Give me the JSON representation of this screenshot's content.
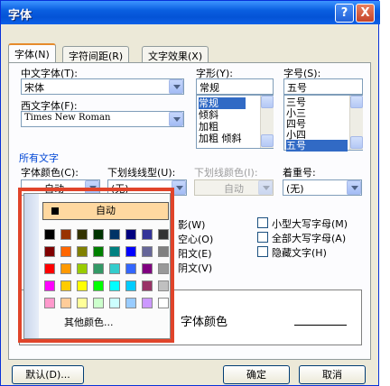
{
  "dialog": {
    "title": "字体",
    "help_label": "?",
    "close_label": "X"
  },
  "tabs": [
    "字体(N)",
    "字符间距(R)",
    "文字效果(X)"
  ],
  "labels": {
    "cn_font": "中文字体(T):",
    "west_font": "西文字体(F):",
    "style": "字形(Y):",
    "size": "字号(S):",
    "all_text": "所有文字",
    "font_color": "字体颜色(C):",
    "underline_type": "下划线线型(U):",
    "underline_color": "下划线颜色(I):",
    "emphasis": "着重号:"
  },
  "fields": {
    "cn_font": "宋体",
    "west_font": "Times New Roman",
    "style": "常规",
    "size": "五号",
    "font_color": "自动",
    "underline_type": "(无)",
    "underline_color": "自动",
    "emphasis": "(无)"
  },
  "style_list": [
    "常规",
    "倾斜",
    "加粗",
    "加粗 倾斜"
  ],
  "size_list": [
    "三号",
    "小三",
    "四号",
    "小四",
    "五号"
  ],
  "effects_left_partial": [
    "影(W)",
    "空心(O)",
    "阳文(E)",
    "阴文(V)"
  ],
  "effects_right": [
    "小型大写字母(M)",
    "全部大写字母(A)",
    "隐藏文字(H)"
  ],
  "preview_text": "字体颜色",
  "palette": {
    "auto_label": "自动",
    "more_label": "其他颜色...",
    "colors": [
      [
        "#000000",
        "#993300",
        "#333300",
        "#003300",
        "#003366",
        "#000080",
        "#333399",
        "#333333"
      ],
      [
        "#800000",
        "#FF6600",
        "#808000",
        "#008000",
        "#008080",
        "#0000FF",
        "#666699",
        "#808080"
      ],
      [
        "#FF0000",
        "#FF9900",
        "#99CC00",
        "#339966",
        "#33CCCC",
        "#3366FF",
        "#800080",
        "#999999"
      ],
      [
        "#FF00FF",
        "#FFCC00",
        "#FFFF00",
        "#00FF00",
        "#00FFFF",
        "#00CCFF",
        "#993366",
        "#C0C0C0"
      ],
      [
        "#FF99CC",
        "#FFCC99",
        "#FFFF99",
        "#CCFFCC",
        "#CCFFFF",
        "#99CCFF",
        "#CC99FF",
        "#FFFFFF"
      ]
    ]
  },
  "buttons": {
    "default": "默认(D)...",
    "ok": "确定",
    "cancel": "取消"
  },
  "colors": {
    "title_blue": "#0453d6",
    "highlight": "#316ac5",
    "outline_red": "#e0442a"
  }
}
